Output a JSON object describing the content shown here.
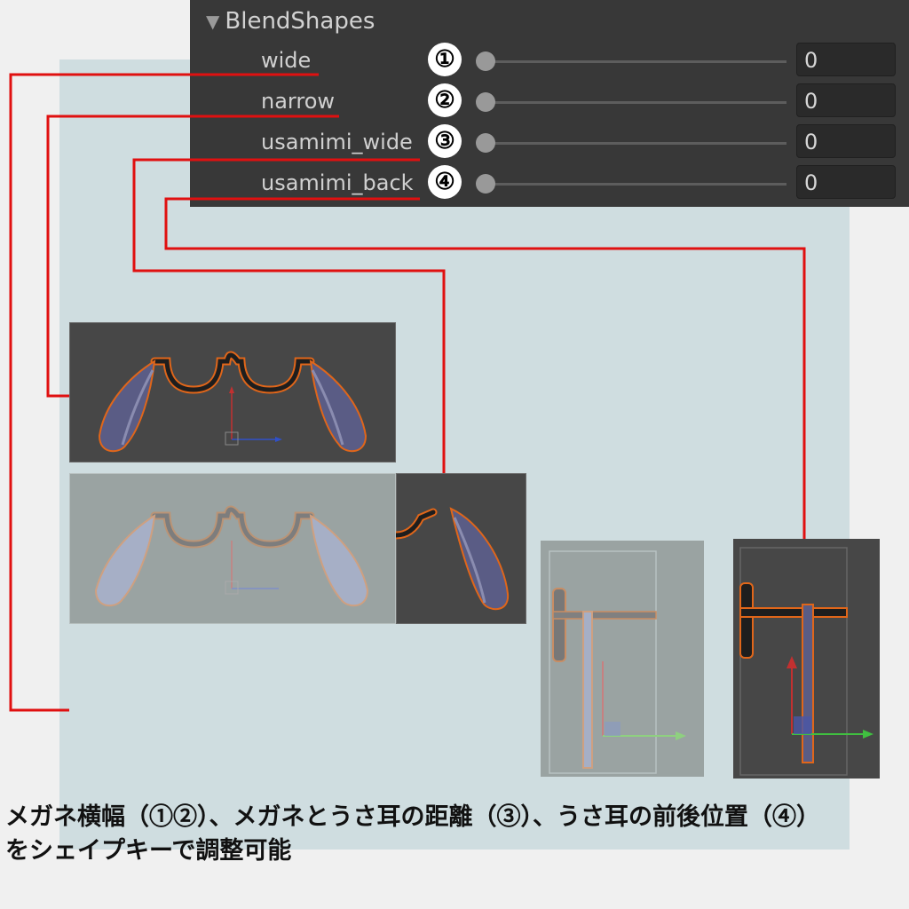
{
  "inspector": {
    "header_label": "BlendShapes",
    "rows": [
      {
        "label": "wide",
        "marker": "①",
        "value": "0",
        "level": 0
      },
      {
        "label": "narrow",
        "marker": "②",
        "value": "0",
        "level": 0
      },
      {
        "label": "usamimi_wide",
        "marker": "③",
        "value": "0",
        "level": 0
      },
      {
        "label": "usamimi_back",
        "marker": "④",
        "value": "0",
        "level": 0
      }
    ]
  },
  "caption": {
    "line1": "メガネ横幅（①②）、メガネとうさ耳の距離（③）、うさ耳の前後位置（④）",
    "line2": "をシェイプキーで調整可能"
  },
  "colors": {
    "leader_line": "#e01010",
    "lens_fill": "#5a5c85",
    "outline": "#e0661a",
    "viewport_bg": "#474747",
    "panel_bg": "#cfdde0"
  }
}
